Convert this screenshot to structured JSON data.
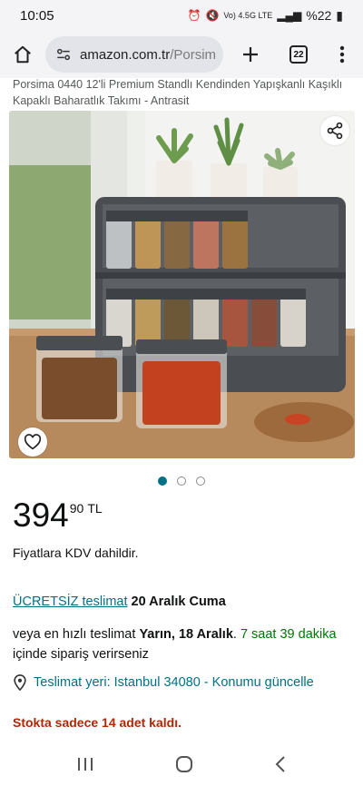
{
  "status_bar": {
    "time": "10:05",
    "network": "Vo) 4.5G LTE",
    "battery": "%22"
  },
  "browser": {
    "url_host": "amazon.com.tr",
    "url_path": "/Porsim",
    "tab_count": "22"
  },
  "product": {
    "title": "Porsima 0440 12'li Premium Standlı Kendinden Yapışkanlı Kaşıklı Kapaklı Baharatlık Takımı - Antrasit",
    "image_count": 3,
    "active_image": 1
  },
  "price": {
    "whole": "394",
    "fraction": "90",
    "currency": "TL"
  },
  "vat_note": "Fiyatlara KDV dahildir.",
  "delivery": {
    "free_label": "ÜCRETSİZ teslimat",
    "date": "20 Aralık Cuma"
  },
  "fast_delivery": {
    "prefix": "veya en hızlı teslimat",
    "date": "Yarın, 18 Aralık",
    "time": "7 saat 39 dakika",
    "suffix": "içinde sipariş verirseniz"
  },
  "location": {
    "text": "Teslimat yeri: Istanbul 34080 - Konumu güncelle"
  },
  "stock": "Stokta sadece 14 adet kaldı.",
  "colors": {
    "link": "#007185",
    "green": "#007600",
    "stock_red": "#b12704"
  }
}
